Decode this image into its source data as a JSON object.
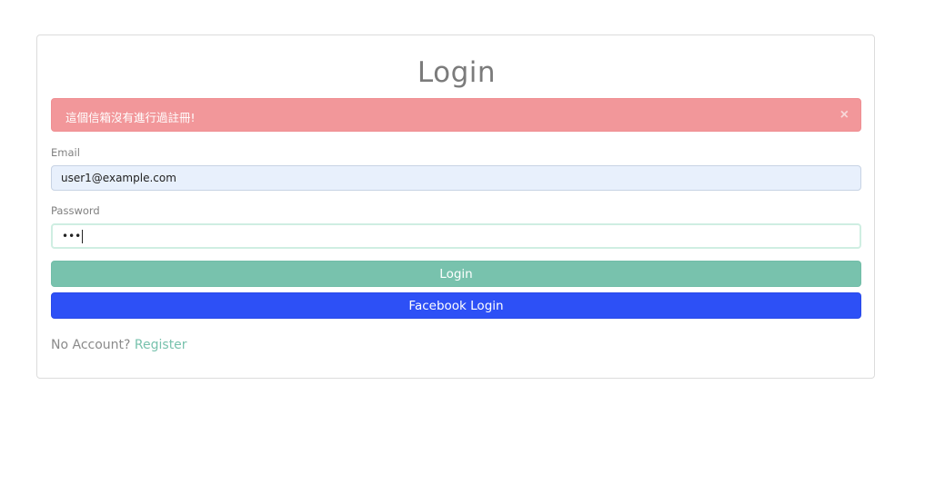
{
  "login_card": {
    "title": "Login",
    "alert": {
      "message": "這個信箱沒有進行過註冊!",
      "close_glyph": "×"
    },
    "email": {
      "label": "Email",
      "value": "user1@example.com"
    },
    "password": {
      "label": "Password",
      "masked_value": "•••"
    },
    "login_button": "Login",
    "facebook_button": "Facebook Login",
    "footer": {
      "prompt": "No Account?",
      "register_link": "Register"
    }
  },
  "colors": {
    "alert_bg": "#f2979a",
    "primary": "#78c2ad",
    "facebook": "#2d50f6",
    "autofill_bg": "#e8f0fc"
  }
}
